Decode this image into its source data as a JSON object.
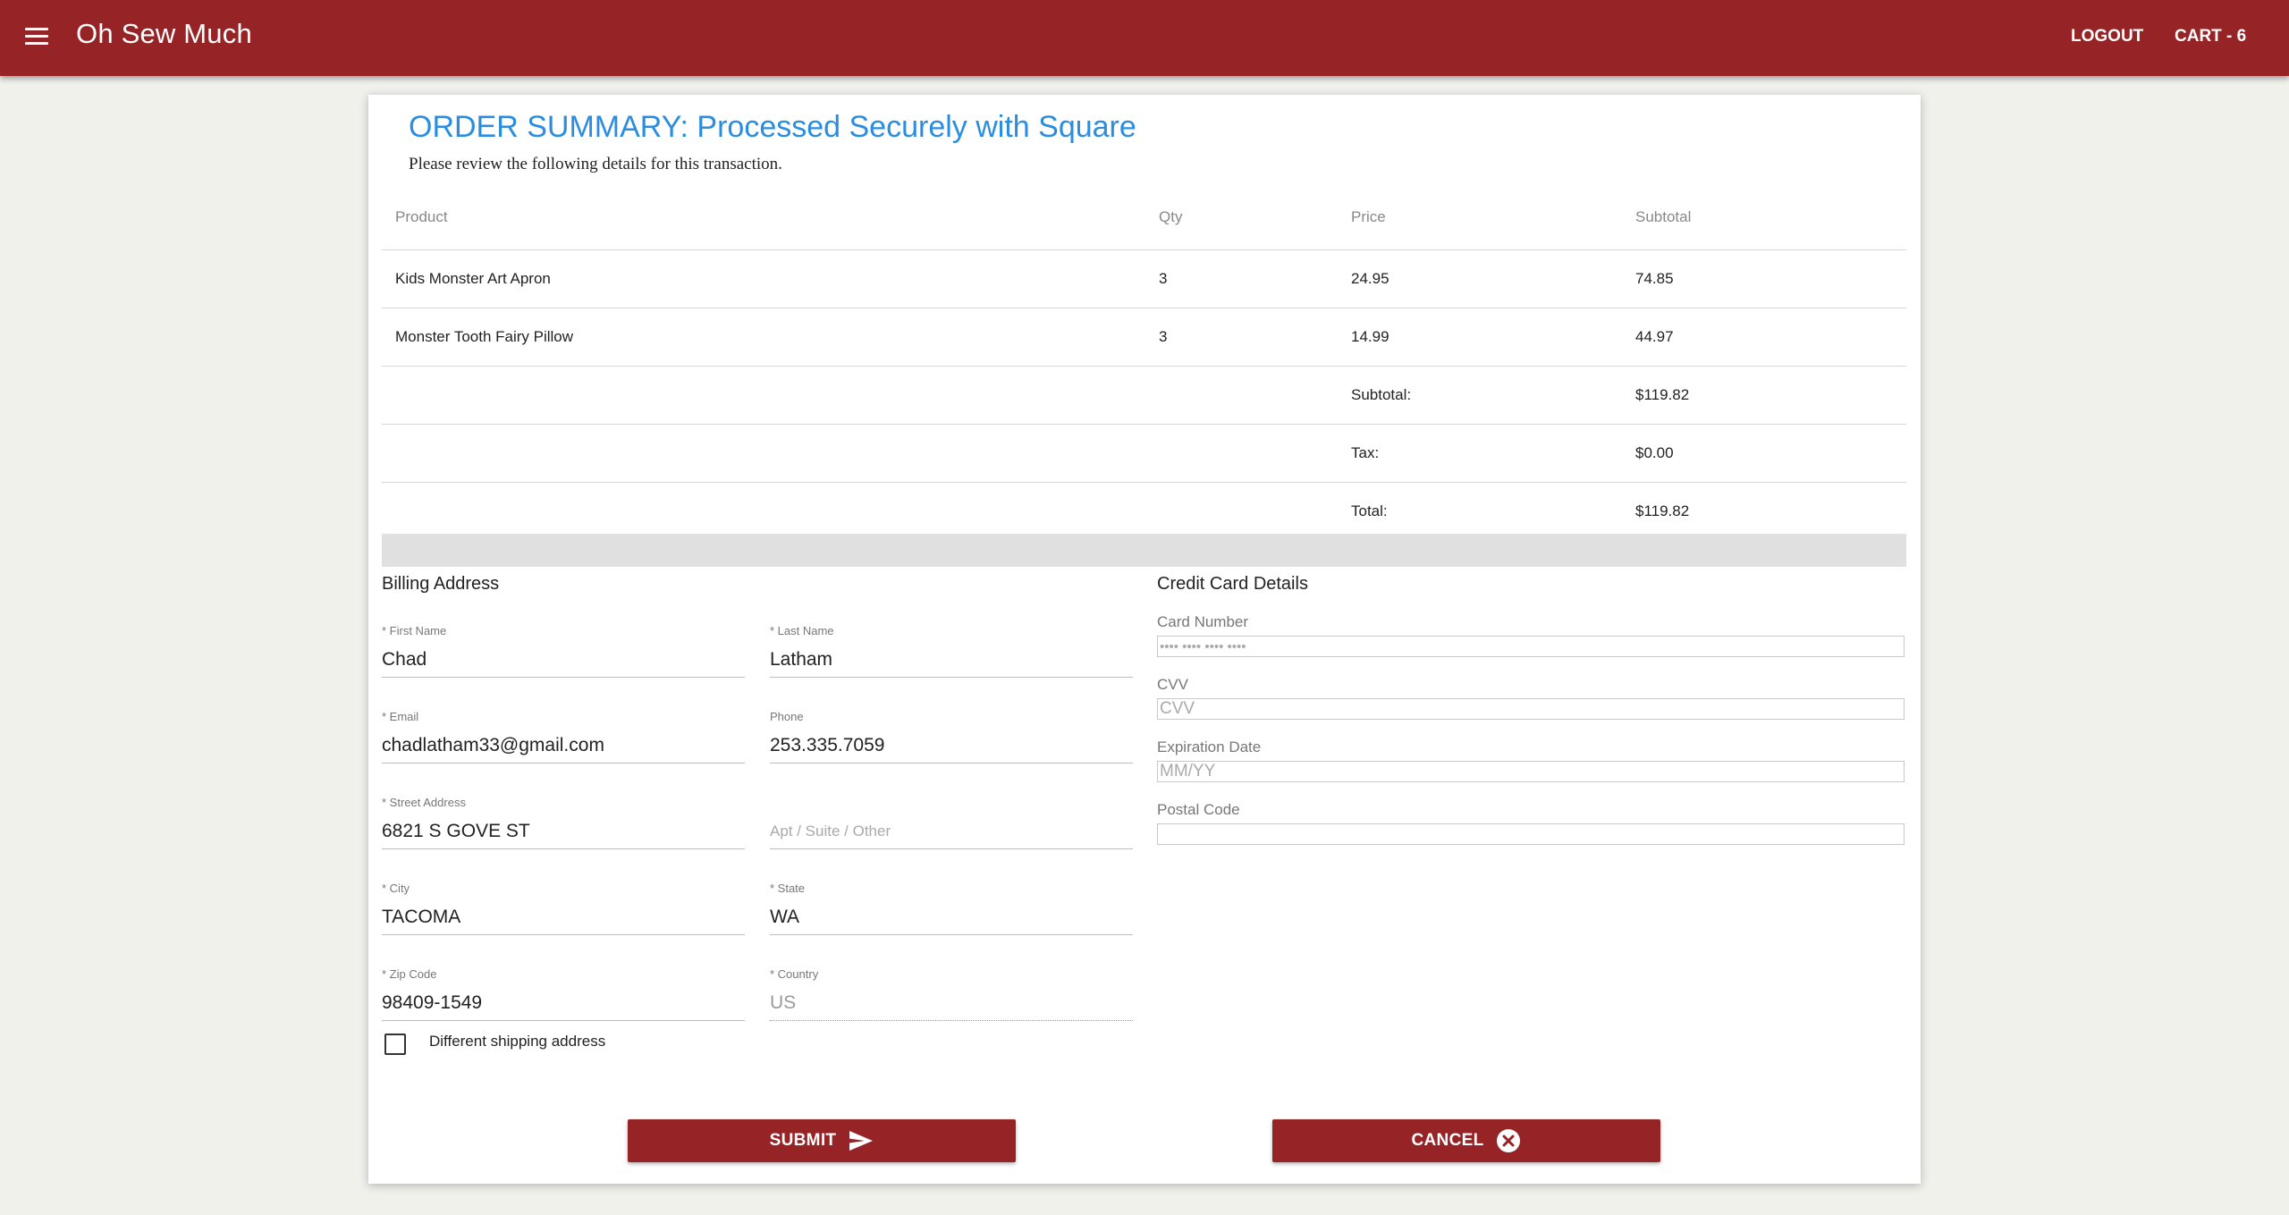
{
  "appbar": {
    "title": "Oh Sew Much",
    "logout": "LOGOUT",
    "cart": "CART - 6",
    "menu_icon": "menu-icon"
  },
  "summary": {
    "title": "ORDER SUMMARY: Processed Securely with Square",
    "subtitle": "Please review the following details for this transaction."
  },
  "table": {
    "headers": {
      "product": "Product",
      "qty": "Qty",
      "price": "Price",
      "subtotal": "Subtotal"
    },
    "rows": [
      {
        "product": "Kids Monster Art Apron",
        "qty": "3",
        "price": "24.95",
        "subtotal": "74.85"
      },
      {
        "product": "Monster Tooth Fairy Pillow",
        "qty": "3",
        "price": "14.99",
        "subtotal": "44.97"
      }
    ],
    "totals": [
      {
        "label": "Subtotal:",
        "value": "$119.82"
      },
      {
        "label": "Tax:",
        "value": "$0.00"
      },
      {
        "label": "Total:",
        "value": "$119.82"
      }
    ]
  },
  "billing": {
    "title": "Billing Address",
    "first_name": {
      "label": "* First Name",
      "value": "Chad"
    },
    "last_name": {
      "label": "* Last Name",
      "value": "Latham"
    },
    "email": {
      "label": "* Email",
      "value": "chadlatham33@gmail.com"
    },
    "phone": {
      "label": "Phone",
      "value": "253.335.7059"
    },
    "street": {
      "label": "* Street Address",
      "value": "6821 S GOVE ST"
    },
    "apt": {
      "label": "",
      "placeholder": "Apt / Suite / Other"
    },
    "city": {
      "label": "* City",
      "value": "TACOMA"
    },
    "state": {
      "label": "* State",
      "value": "WA"
    },
    "zip": {
      "label": "* Zip Code",
      "value": "98409-1549"
    },
    "country": {
      "label": "* Country",
      "value": "US"
    },
    "different_shipping": "Different shipping address"
  },
  "credit_card": {
    "title": "Credit Card Details",
    "card_number": {
      "label": "Card Number",
      "placeholder": "•••• •••• •••• ••••"
    },
    "cvv": {
      "label": "CVV",
      "placeholder": "CVV"
    },
    "expiration": {
      "label": "Expiration Date",
      "placeholder": "MM/YY"
    },
    "postal": {
      "label": "Postal Code",
      "placeholder": ""
    }
  },
  "actions": {
    "submit": "SUBMIT",
    "submit_icon": "send-icon",
    "cancel": "CANCEL",
    "cancel_icon": "cancel-circle-icon"
  },
  "colors": {
    "brand": "#962326",
    "title_blue": "#2b8de0",
    "background": "#f1f1ec"
  }
}
